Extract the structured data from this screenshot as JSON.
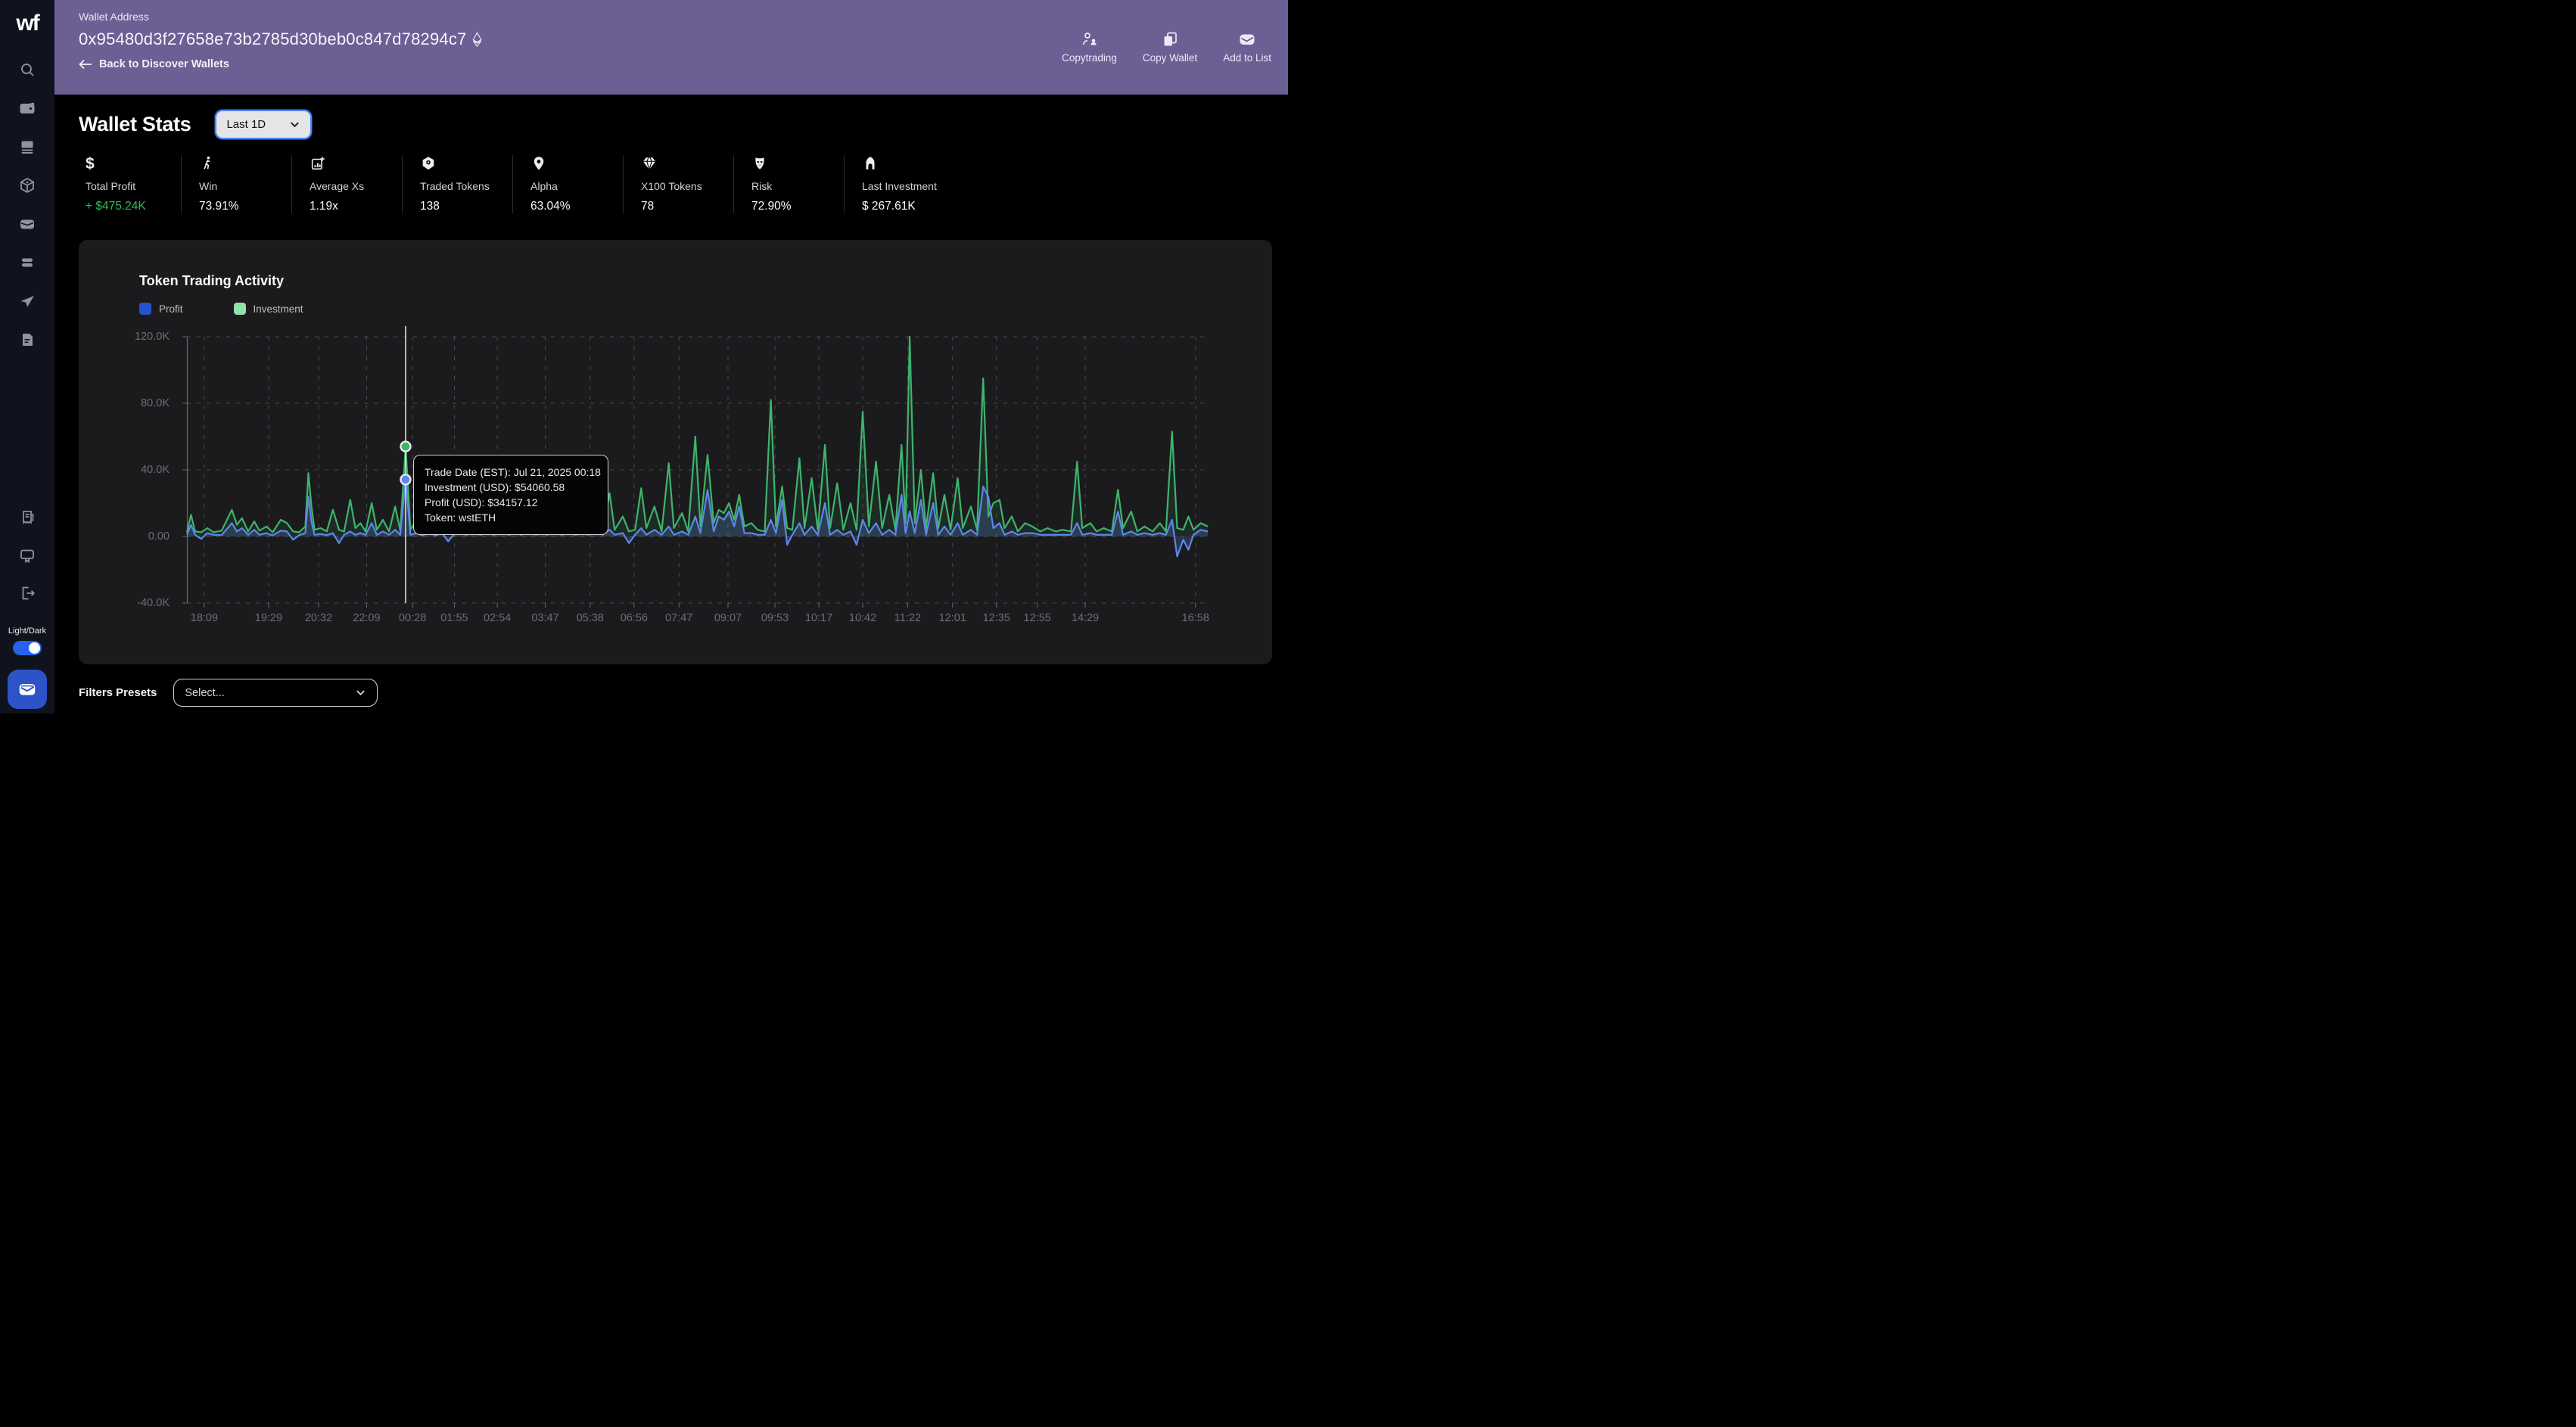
{
  "sidebar": {
    "logo": "wf",
    "nav_icons": [
      "search-icon",
      "wallet-icon",
      "stack-icon",
      "cube-icon",
      "card-icon",
      "layers-icon",
      "telegram-icon",
      "document-icon"
    ],
    "bottom_icons": [
      "receipt-icon",
      "monitor-icon",
      "logout-icon"
    ],
    "theme_label": "Light/Dark",
    "accent_button_color": "#2d53c8"
  },
  "header": {
    "background_color": "#6b5f94",
    "wallet_address_label": "Wallet Address",
    "wallet_address": "0x95480d3f27658e73b2785d30beb0c847d78294c7",
    "address_icon": "ethereum-icon",
    "back_link": "Back to Discover Wallets",
    "actions": [
      {
        "label": "Copytrading",
        "icon": "copytrading-icon"
      },
      {
        "label": "Copy Wallet",
        "icon": "copy-icon"
      },
      {
        "label": "Add to List",
        "icon": "add-to-list-icon"
      }
    ]
  },
  "wallet_stats": {
    "title": "Wallet Stats",
    "period_selector_value": "Last 1D",
    "stats": [
      {
        "label": "Total Profit",
        "value": "+ $475.24K",
        "icon": "dollar-icon",
        "value_color": "#2ebd59"
      },
      {
        "label": "Win",
        "value": "73.91%",
        "icon": "walking-person-icon"
      },
      {
        "label": "Average Xs",
        "value": "1.19x",
        "icon": "chart-plus-icon"
      },
      {
        "label": "Traded Tokens",
        "value": "138",
        "icon": "token-box-icon"
      },
      {
        "label": "Alpha",
        "value": "63.04%",
        "icon": "alpha-pin-icon"
      },
      {
        "label": "X100 Tokens",
        "value": "78",
        "icon": "gem-icon"
      },
      {
        "label": "Risk",
        "value": "72.90%",
        "icon": "mask-icon"
      },
      {
        "label": "Last Investment",
        "value": "$ 267.61K",
        "icon": "arch-icon"
      }
    ]
  },
  "chart_data": {
    "type": "line",
    "title": "Token Trading Activity",
    "xlabel": "",
    "ylabel": "",
    "units": "USD (thousands)",
    "grid": "dashed",
    "legend_position": "top-left",
    "legend": [
      {
        "name": "Profit",
        "chip_color": "#2553cd",
        "line_color": "#5d87ea"
      },
      {
        "name": "Investment",
        "chip_color": "#90e2a9",
        "line_color": "#3eb46c"
      }
    ],
    "ylim": [
      -40,
      120
    ],
    "y_ticks": [
      {
        "label": "120.0K",
        "value": 120
      },
      {
        "label": "80.0K",
        "value": 80
      },
      {
        "label": "40.0K",
        "value": 40
      },
      {
        "label": "0.00",
        "value": 0
      },
      {
        "label": "-40.0K",
        "value": -40
      }
    ],
    "x_ticks": [
      {
        "label": "18:09",
        "pos": 0.017
      },
      {
        "label": "19:29",
        "pos": 0.08
      },
      {
        "label": "20:32",
        "pos": 0.129
      },
      {
        "label": "22:09",
        "pos": 0.176
      },
      {
        "label": "00:28",
        "pos": 0.221
      },
      {
        "label": "01:55",
        "pos": 0.262
      },
      {
        "label": "02:54",
        "pos": 0.304
      },
      {
        "label": "03:47",
        "pos": 0.351
      },
      {
        "label": "05:38",
        "pos": 0.395
      },
      {
        "label": "06:56",
        "pos": 0.438
      },
      {
        "label": "07:47",
        "pos": 0.482
      },
      {
        "label": "09:07",
        "pos": 0.53
      },
      {
        "label": "09:53",
        "pos": 0.576
      },
      {
        "label": "10:17",
        "pos": 0.619
      },
      {
        "label": "10:42",
        "pos": 0.662
      },
      {
        "label": "11:22",
        "pos": 0.706
      },
      {
        "label": "12:01",
        "pos": 0.75
      },
      {
        "label": "12:35",
        "pos": 0.793
      },
      {
        "label": "12:55",
        "pos": 0.833
      },
      {
        "label": "14:29",
        "pos": 0.88
      },
      {
        "label": "16:58",
        "pos": 0.988
      }
    ],
    "points_format": [
      "x_fraction",
      "investment_k_usd",
      "profit_k_usd"
    ],
    "points": [
      [
        0.0,
        2.5,
        1
      ],
      [
        0.004,
        13,
        7
      ],
      [
        0.008,
        3,
        1
      ],
      [
        0.014,
        2.5,
        -1.5
      ],
      [
        0.02,
        5,
        2
      ],
      [
        0.026,
        2.5,
        1
      ],
      [
        0.034,
        3.5,
        0.8
      ],
      [
        0.044,
        16,
        8
      ],
      [
        0.049,
        7,
        3
      ],
      [
        0.054,
        11,
        5
      ],
      [
        0.06,
        3,
        1
      ],
      [
        0.066,
        9,
        4
      ],
      [
        0.071,
        3.5,
        1
      ],
      [
        0.078,
        6,
        2
      ],
      [
        0.084,
        2.5,
        0.6
      ],
      [
        0.092,
        10,
        3.5
      ],
      [
        0.098,
        8,
        3
      ],
      [
        0.104,
        3,
        -2
      ],
      [
        0.11,
        2.5,
        0.8
      ],
      [
        0.116,
        6,
        2
      ],
      [
        0.119,
        38,
        24
      ],
      [
        0.122,
        18,
        9
      ],
      [
        0.125,
        4,
        1
      ],
      [
        0.131,
        5,
        1.5
      ],
      [
        0.137,
        3,
        0.8
      ],
      [
        0.143,
        16,
        2
      ],
      [
        0.149,
        4,
        -4
      ],
      [
        0.154,
        3,
        1
      ],
      [
        0.16,
        22,
        3
      ],
      [
        0.165,
        5,
        1
      ],
      [
        0.17,
        8,
        2
      ],
      [
        0.175,
        3,
        1
      ],
      [
        0.181,
        20,
        8
      ],
      [
        0.186,
        4,
        1
      ],
      [
        0.192,
        10,
        3
      ],
      [
        0.198,
        3,
        1
      ],
      [
        0.204,
        18,
        4
      ],
      [
        0.209,
        3.5,
        1
      ],
      [
        0.2142,
        54.06,
        34.157
      ],
      [
        0.219,
        4,
        1
      ],
      [
        0.225,
        10,
        2
      ],
      [
        0.231,
        3,
        0.6
      ],
      [
        0.238,
        21,
        3
      ],
      [
        0.243,
        4,
        0.6
      ],
      [
        0.25,
        6,
        2
      ],
      [
        0.256,
        3,
        -3
      ],
      [
        0.261,
        4,
        1
      ],
      [
        0.268,
        30,
        4
      ],
      [
        0.273,
        5,
        1
      ],
      [
        0.281,
        8,
        2
      ],
      [
        0.288,
        3,
        1
      ],
      [
        0.295,
        26,
        5
      ],
      [
        0.3,
        4,
        1
      ],
      [
        0.308,
        6,
        2
      ],
      [
        0.316,
        3,
        1
      ],
      [
        0.322,
        28,
        6
      ],
      [
        0.327,
        5,
        1
      ],
      [
        0.335,
        12,
        3
      ],
      [
        0.342,
        3,
        1
      ],
      [
        0.348,
        19,
        4
      ],
      [
        0.353,
        4,
        1
      ],
      [
        0.36,
        17,
        3
      ],
      [
        0.367,
        3,
        1
      ],
      [
        0.374,
        10,
        2
      ],
      [
        0.381,
        3,
        1
      ],
      [
        0.388,
        20,
        3
      ],
      [
        0.393,
        4,
        1
      ],
      [
        0.4,
        15,
        3
      ],
      [
        0.407,
        3,
        1
      ],
      [
        0.414,
        26,
        4
      ],
      [
        0.419,
        4,
        1
      ],
      [
        0.427,
        12,
        2
      ],
      [
        0.433,
        3,
        -4
      ],
      [
        0.439,
        4,
        1
      ],
      [
        0.445,
        29,
        5
      ],
      [
        0.45,
        5,
        1
      ],
      [
        0.458,
        18,
        4
      ],
      [
        0.465,
        3,
        1
      ],
      [
        0.472,
        44,
        6
      ],
      [
        0.477,
        5,
        1
      ],
      [
        0.485,
        14,
        3
      ],
      [
        0.491,
        3,
        1
      ],
      [
        0.498,
        60,
        12
      ],
      [
        0.503,
        6,
        2
      ],
      [
        0.51,
        49,
        28
      ],
      [
        0.516,
        8,
        3
      ],
      [
        0.521,
        16,
        12
      ],
      [
        0.526,
        14,
        10
      ],
      [
        0.531,
        20,
        15
      ],
      [
        0.536,
        10,
        6
      ],
      [
        0.541,
        25,
        18
      ],
      [
        0.546,
        6,
        2
      ],
      [
        0.553,
        8,
        2
      ],
      [
        0.559,
        4,
        1
      ],
      [
        0.566,
        3,
        1
      ],
      [
        0.572,
        82,
        10
      ],
      [
        0.577,
        6,
        2
      ],
      [
        0.583,
        30,
        22
      ],
      [
        0.588,
        5,
        -5
      ],
      [
        0.593,
        4,
        1
      ],
      [
        0.6,
        47,
        8
      ],
      [
        0.605,
        5,
        1
      ],
      [
        0.612,
        35,
        6
      ],
      [
        0.618,
        4,
        1
      ],
      [
        0.625,
        55,
        20
      ],
      [
        0.63,
        5,
        1
      ],
      [
        0.637,
        32,
        4
      ],
      [
        0.643,
        4,
        1
      ],
      [
        0.65,
        20,
        3
      ],
      [
        0.656,
        4,
        -5
      ],
      [
        0.662,
        75,
        10
      ],
      [
        0.668,
        6,
        2
      ],
      [
        0.675,
        45,
        8
      ],
      [
        0.681,
        5,
        1
      ],
      [
        0.688,
        25,
        4
      ],
      [
        0.694,
        4,
        1
      ],
      [
        0.7,
        55,
        25
      ],
      [
        0.704,
        8,
        2
      ],
      [
        0.708,
        120,
        15
      ],
      [
        0.713,
        8,
        2
      ],
      [
        0.719,
        40,
        22
      ],
      [
        0.724,
        5,
        1
      ],
      [
        0.731,
        38,
        20
      ],
      [
        0.736,
        5,
        1
      ],
      [
        0.742,
        25,
        6
      ],
      [
        0.748,
        4,
        1
      ],
      [
        0.755,
        35,
        8
      ],
      [
        0.76,
        5,
        1
      ],
      [
        0.768,
        18,
        4
      ],
      [
        0.774,
        4,
        1
      ],
      [
        0.78,
        95,
        30
      ],
      [
        0.785,
        12,
        24
      ],
      [
        0.79,
        20,
        5
      ],
      [
        0.796,
        22,
        8
      ],
      [
        0.801,
        5,
        1
      ],
      [
        0.808,
        12,
        3
      ],
      [
        0.814,
        3,
        1
      ],
      [
        0.821,
        8,
        2
      ],
      [
        0.828,
        6,
        2
      ],
      [
        0.836,
        3,
        1
      ],
      [
        0.843,
        5,
        1
      ],
      [
        0.851,
        3,
        1
      ],
      [
        0.858,
        4,
        1
      ],
      [
        0.866,
        3,
        1
      ],
      [
        0.872,
        45,
        8
      ],
      [
        0.877,
        5,
        1
      ],
      [
        0.885,
        8,
        2
      ],
      [
        0.891,
        3,
        1
      ],
      [
        0.898,
        5,
        1
      ],
      [
        0.906,
        3,
        1
      ],
      [
        0.912,
        28,
        15
      ],
      [
        0.917,
        5,
        1
      ],
      [
        0.925,
        15,
        3
      ],
      [
        0.931,
        3,
        1
      ],
      [
        0.938,
        6,
        2
      ],
      [
        0.946,
        3,
        1
      ],
      [
        0.953,
        8,
        2
      ],
      [
        0.959,
        3,
        1
      ],
      [
        0.965,
        63,
        10
      ],
      [
        0.97,
        5,
        -12
      ],
      [
        0.976,
        4,
        -2
      ],
      [
        0.981,
        12,
        -8
      ],
      [
        0.986,
        4,
        1
      ],
      [
        0.993,
        8,
        4
      ],
      [
        1.0,
        6,
        3
      ]
    ],
    "crosshair": {
      "pos": 0.2142,
      "investment_k": 54.06,
      "profit_k": 34.157
    },
    "tooltip": {
      "lines": [
        "Trade Date (EST): Jul 21, 2025 00:18",
        "Investment (USD): $54060.58",
        "Profit (USD): $34157.12",
        "Token: wstETH"
      ]
    }
  },
  "filters": {
    "label": "Filters Presets",
    "placeholder": "Select..."
  }
}
